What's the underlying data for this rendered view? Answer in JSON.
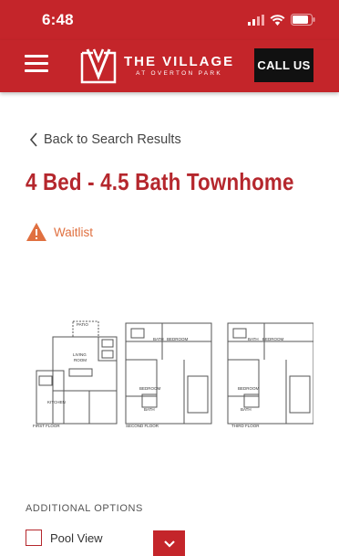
{
  "status": {
    "time": "6:48"
  },
  "header": {
    "logo_main": "THE VILLAGE",
    "logo_sub": "AT OVERTON PARK",
    "call_label": "CALL US"
  },
  "nav": {
    "back_label": "Back to Search Results"
  },
  "unit": {
    "title": "4 Bed - 4.5 Bath Townhome",
    "status_label": "Waitlist"
  },
  "floorplan": {
    "labels": {
      "patio": "PATIO",
      "living": "LIVING",
      "room": "ROOM",
      "kitchen": "KITCHEN",
      "first_floor": "FIRST FLOOR",
      "bath": "BATH",
      "bedroom": "BEDROOM",
      "second_floor": "SECOND FLOOR",
      "third_floor": "THIRD FLOOR"
    }
  },
  "options": {
    "heading": "ADDITIONAL OPTIONS",
    "items": [
      {
        "label": "Pool View",
        "checked": false
      }
    ]
  },
  "colors": {
    "brand_red": "#c4252a",
    "title_red": "#b5272d",
    "warning_orange": "#e07040"
  }
}
